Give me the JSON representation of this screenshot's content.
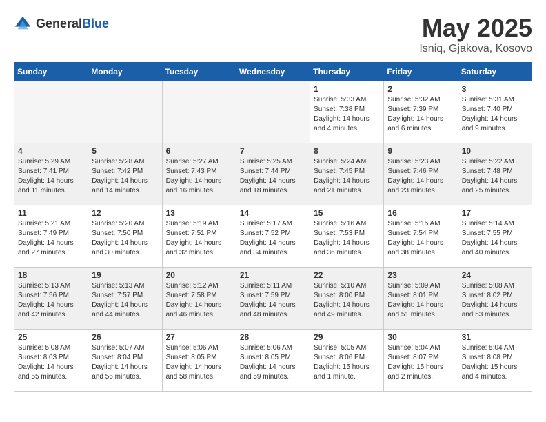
{
  "header": {
    "logo_general": "General",
    "logo_blue": "Blue",
    "title": "May 2025",
    "location": "Isniq, Gjakova, Kosovo"
  },
  "days_of_week": [
    "Sunday",
    "Monday",
    "Tuesday",
    "Wednesday",
    "Thursday",
    "Friday",
    "Saturday"
  ],
  "weeks": [
    [
      {
        "day": "",
        "empty": true
      },
      {
        "day": "",
        "empty": true
      },
      {
        "day": "",
        "empty": true
      },
      {
        "day": "",
        "empty": true
      },
      {
        "day": "1",
        "sunrise": "5:33 AM",
        "sunset": "7:38 PM",
        "daylight": "14 hours and 4 minutes."
      },
      {
        "day": "2",
        "sunrise": "5:32 AM",
        "sunset": "7:39 PM",
        "daylight": "14 hours and 6 minutes."
      },
      {
        "day": "3",
        "sunrise": "5:31 AM",
        "sunset": "7:40 PM",
        "daylight": "14 hours and 9 minutes."
      }
    ],
    [
      {
        "day": "4",
        "sunrise": "5:29 AM",
        "sunset": "7:41 PM",
        "daylight": "14 hours and 11 minutes."
      },
      {
        "day": "5",
        "sunrise": "5:28 AM",
        "sunset": "7:42 PM",
        "daylight": "14 hours and 14 minutes."
      },
      {
        "day": "6",
        "sunrise": "5:27 AM",
        "sunset": "7:43 PM",
        "daylight": "14 hours and 16 minutes."
      },
      {
        "day": "7",
        "sunrise": "5:25 AM",
        "sunset": "7:44 PM",
        "daylight": "14 hours and 18 minutes."
      },
      {
        "day": "8",
        "sunrise": "5:24 AM",
        "sunset": "7:45 PM",
        "daylight": "14 hours and 21 minutes."
      },
      {
        "day": "9",
        "sunrise": "5:23 AM",
        "sunset": "7:46 PM",
        "daylight": "14 hours and 23 minutes."
      },
      {
        "day": "10",
        "sunrise": "5:22 AM",
        "sunset": "7:48 PM",
        "daylight": "14 hours and 25 minutes."
      }
    ],
    [
      {
        "day": "11",
        "sunrise": "5:21 AM",
        "sunset": "7:49 PM",
        "daylight": "14 hours and 27 minutes."
      },
      {
        "day": "12",
        "sunrise": "5:20 AM",
        "sunset": "7:50 PM",
        "daylight": "14 hours and 30 minutes."
      },
      {
        "day": "13",
        "sunrise": "5:19 AM",
        "sunset": "7:51 PM",
        "daylight": "14 hours and 32 minutes."
      },
      {
        "day": "14",
        "sunrise": "5:17 AM",
        "sunset": "7:52 PM",
        "daylight": "14 hours and 34 minutes."
      },
      {
        "day": "15",
        "sunrise": "5:16 AM",
        "sunset": "7:53 PM",
        "daylight": "14 hours and 36 minutes."
      },
      {
        "day": "16",
        "sunrise": "5:15 AM",
        "sunset": "7:54 PM",
        "daylight": "14 hours and 38 minutes."
      },
      {
        "day": "17",
        "sunrise": "5:14 AM",
        "sunset": "7:55 PM",
        "daylight": "14 hours and 40 minutes."
      }
    ],
    [
      {
        "day": "18",
        "sunrise": "5:13 AM",
        "sunset": "7:56 PM",
        "daylight": "14 hours and 42 minutes."
      },
      {
        "day": "19",
        "sunrise": "5:13 AM",
        "sunset": "7:57 PM",
        "daylight": "14 hours and 44 minutes."
      },
      {
        "day": "20",
        "sunrise": "5:12 AM",
        "sunset": "7:58 PM",
        "daylight": "14 hours and 46 minutes."
      },
      {
        "day": "21",
        "sunrise": "5:11 AM",
        "sunset": "7:59 PM",
        "daylight": "14 hours and 48 minutes."
      },
      {
        "day": "22",
        "sunrise": "5:10 AM",
        "sunset": "8:00 PM",
        "daylight": "14 hours and 49 minutes."
      },
      {
        "day": "23",
        "sunrise": "5:09 AM",
        "sunset": "8:01 PM",
        "daylight": "14 hours and 51 minutes."
      },
      {
        "day": "24",
        "sunrise": "5:08 AM",
        "sunset": "8:02 PM",
        "daylight": "14 hours and 53 minutes."
      }
    ],
    [
      {
        "day": "25",
        "sunrise": "5:08 AM",
        "sunset": "8:03 PM",
        "daylight": "14 hours and 55 minutes."
      },
      {
        "day": "26",
        "sunrise": "5:07 AM",
        "sunset": "8:04 PM",
        "daylight": "14 hours and 56 minutes."
      },
      {
        "day": "27",
        "sunrise": "5:06 AM",
        "sunset": "8:05 PM",
        "daylight": "14 hours and 58 minutes."
      },
      {
        "day": "28",
        "sunrise": "5:06 AM",
        "sunset": "8:05 PM",
        "daylight": "14 hours and 59 minutes."
      },
      {
        "day": "29",
        "sunrise": "5:05 AM",
        "sunset": "8:06 PM",
        "daylight": "15 hours and 1 minute."
      },
      {
        "day": "30",
        "sunrise": "5:04 AM",
        "sunset": "8:07 PM",
        "daylight": "15 hours and 2 minutes."
      },
      {
        "day": "31",
        "sunrise": "5:04 AM",
        "sunset": "8:08 PM",
        "daylight": "15 hours and 4 minutes."
      }
    ]
  ],
  "labels": {
    "sunrise_prefix": "Sunrise: ",
    "sunset_prefix": "Sunset: ",
    "daylight_prefix": "Daylight: "
  }
}
